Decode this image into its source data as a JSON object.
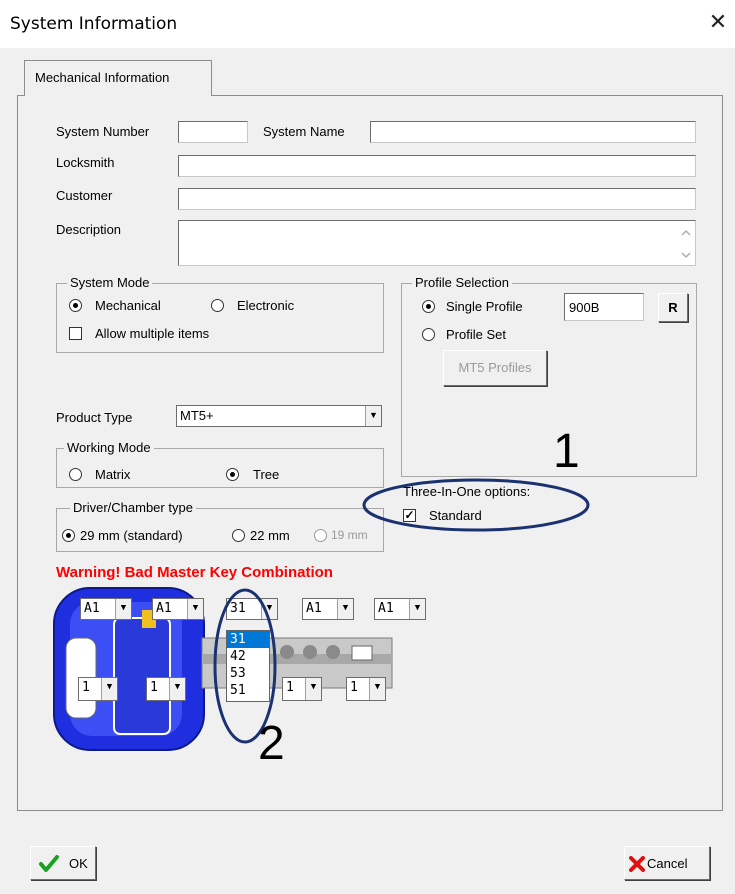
{
  "window": {
    "title": "System Information",
    "close_glyph": "✕"
  },
  "tabs": [
    {
      "label": "Mechanical Information"
    }
  ],
  "fields": {
    "system_number_label": "System Number",
    "system_number_value": "",
    "system_name_label": "System Name",
    "system_name_value": "",
    "locksmith_label": "Locksmith",
    "locksmith_value": "",
    "customer_label": "Customer",
    "customer_value": "",
    "description_label": "Description",
    "description_value": ""
  },
  "system_mode": {
    "title": "System Mode",
    "mechanical_label": "Mechanical",
    "electronic_label": "Electronic",
    "allow_multiple_label": "Allow multiple items",
    "selected": "Mechanical"
  },
  "profile_selection": {
    "title": "Profile Selection",
    "single_profile_label": "Single Profile",
    "single_profile_value": "900B",
    "r_button_label": "R",
    "profile_set_label": "Profile Set",
    "mt5_profiles_label": "MT5 Profiles",
    "selected": "Single Profile"
  },
  "product_type": {
    "label": "Product Type",
    "value": "MT5+"
  },
  "working_mode": {
    "title": "Working Mode",
    "matrix_label": "Matrix",
    "tree_label": "Tree",
    "selected": "Tree"
  },
  "driver_chamber": {
    "title": "Driver/Chamber type",
    "opt_29": "29 mm (standard)",
    "opt_22": "22 mm",
    "opt_19": "19 mm",
    "selected": "29 mm (standard)"
  },
  "three_in_one": {
    "title": "Three-In-One options:",
    "standard_label": "Standard",
    "standard_checked": true
  },
  "warning": "Warning! Bad Master Key Combination",
  "top_dropdowns": [
    "A1",
    "A1",
    "31",
    "A1",
    "A1"
  ],
  "bottom_dropdowns": [
    "1",
    "1",
    "1",
    "1"
  ],
  "open_list_options": [
    "31",
    "42",
    "53",
    "51"
  ],
  "open_list_selected": "31",
  "annotations": {
    "one": "1",
    "two": "2"
  },
  "buttons": {
    "ok_label": "OK",
    "cancel_label": "Cancel"
  },
  "colors": {
    "key_blue": "#1f2fe0",
    "warning_red": "#ff0000",
    "annotation_ellipse": "#1a3270",
    "selected_item": "#0078d7"
  }
}
